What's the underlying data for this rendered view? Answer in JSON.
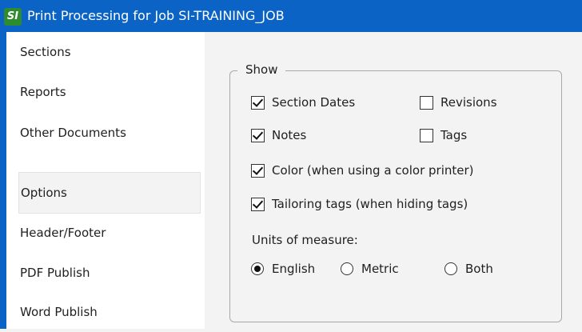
{
  "window": {
    "icon_text": "SI",
    "title": "Print Processing for Job SI-TRAINING_JOB"
  },
  "sidebar": {
    "items": [
      {
        "label": "Sections",
        "selected": false
      },
      {
        "label": "Reports",
        "selected": false
      },
      {
        "label": "Other Documents",
        "selected": false
      },
      {
        "label": "Options",
        "selected": true
      },
      {
        "label": "Header/Footer",
        "selected": false
      },
      {
        "label": "PDF Publish",
        "selected": false
      },
      {
        "label": "Word Publish",
        "selected": false
      }
    ]
  },
  "show": {
    "legend": "Show",
    "section_dates": {
      "label": "Section Dates",
      "checked": true
    },
    "revisions": {
      "label": "Revisions",
      "checked": false
    },
    "notes": {
      "label": "Notes",
      "checked": true
    },
    "tags": {
      "label": "Tags",
      "checked": false
    },
    "color": {
      "label": "Color (when using a color printer)",
      "checked": true
    },
    "tailoring_tags": {
      "label": "Tailoring tags (when hiding tags)",
      "checked": true
    },
    "units_label": "Units of measure:",
    "units": [
      {
        "label": "English",
        "selected": true
      },
      {
        "label": "Metric",
        "selected": false
      },
      {
        "label": "Both",
        "selected": false
      }
    ]
  },
  "colors": {
    "titlebar": "#0a63c5",
    "app_icon": "#2e8b2e"
  }
}
